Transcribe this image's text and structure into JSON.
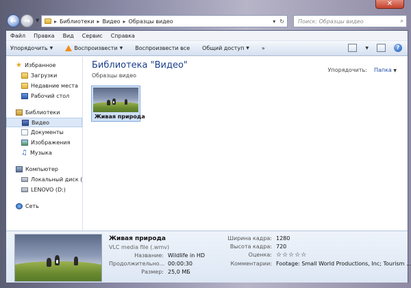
{
  "window": {
    "close_glyph": "✕"
  },
  "address": {
    "crumbs": [
      "Библиотеки",
      "Видео",
      "Образцы видео"
    ],
    "separator": "▸"
  },
  "search": {
    "placeholder": "Поиск: Образцы видео"
  },
  "menu": [
    "Файл",
    "Правка",
    "Вид",
    "Сервис",
    "Справка"
  ],
  "toolbar": {
    "organize": "Упорядочить",
    "play": "Воспроизвести",
    "play_all": "Воспроизвести все",
    "share": "Общий доступ",
    "more": "»"
  },
  "nav": {
    "favorites": {
      "label": "Избранное",
      "items": [
        "Загрузки",
        "Недавние места",
        "Рабочий стол"
      ]
    },
    "libraries": {
      "label": "Библиотеки",
      "items": [
        "Видео",
        "Документы",
        "Изображения",
        "Музыка"
      ],
      "selected": "Видео"
    },
    "computer": {
      "label": "Компьютер",
      "items": [
        "Локальный диск (C",
        "LENOVO (D:)"
      ]
    },
    "network": {
      "label": "Сеть"
    }
  },
  "content": {
    "title": "Библиотека \"Видео\"",
    "subtitle": "Образцы видео",
    "arrange_label": "Упорядочить:",
    "arrange_value": "Папка",
    "files": [
      {
        "name": "Живая природа"
      }
    ]
  },
  "details": {
    "name": "Живая природа",
    "type": "VLC media file (.wmv)",
    "fields_left": [
      {
        "k": "Название:",
        "v": "Wildlife in HD"
      },
      {
        "k": "Продолжительно...",
        "v": "00:00:30"
      },
      {
        "k": "Размер:",
        "v": "25,0 МБ"
      }
    ],
    "fields_right": [
      {
        "k": "Ширина кадра:",
        "v": "1280"
      },
      {
        "k": "Высота кадра:",
        "v": "720"
      },
      {
        "k": "Оценка:",
        "v": "☆☆☆☆☆"
      },
      {
        "k": "Комментарии:",
        "v": "Footage: Small World Productions, Inc; Tourism ..."
      }
    ]
  }
}
